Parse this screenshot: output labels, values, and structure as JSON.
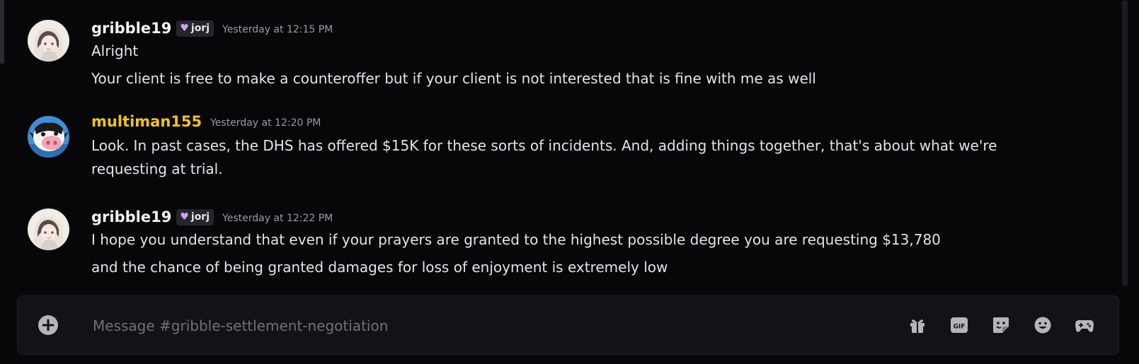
{
  "messages": [
    {
      "username": "gribble19",
      "tag": "jorj",
      "timestamp": "Yesterday at 12:15 PM",
      "lines": [
        "Alright",
        "Your client is free to make a counteroffer but if your client is not interested that is fine with me as well"
      ]
    },
    {
      "username": "multiman155",
      "timestamp": "Yesterday at 12:20 PM",
      "lines": [
        "Look. In past cases, the DHS has offered $15K for these sorts of incidents. And, adding things together, that's about what we're",
        "requesting at trial."
      ]
    },
    {
      "username": "gribble19",
      "tag": "jorj",
      "timestamp": "Yesterday at 12:22 PM",
      "lines": [
        "I hope you understand that even if your prayers are granted to the highest possible degree you are requesting $13,780",
        "and the chance of being granted damages for loss of enjoyment is extremely low"
      ]
    }
  ],
  "composer": {
    "placeholder": "Message #gribble-settlement-negotiation"
  },
  "toolbar_icons": [
    "plus-circle-icon",
    "gift-icon",
    "gif-icon",
    "sticker-icon",
    "emoji-icon",
    "game-controller-icon"
  ],
  "colors": {
    "background": "#070709",
    "username_default": "#f2f3f5",
    "username_gold": "#f0c419",
    "timestamp": "#9a9ba1",
    "tag_heart": "#c9a4f0"
  }
}
